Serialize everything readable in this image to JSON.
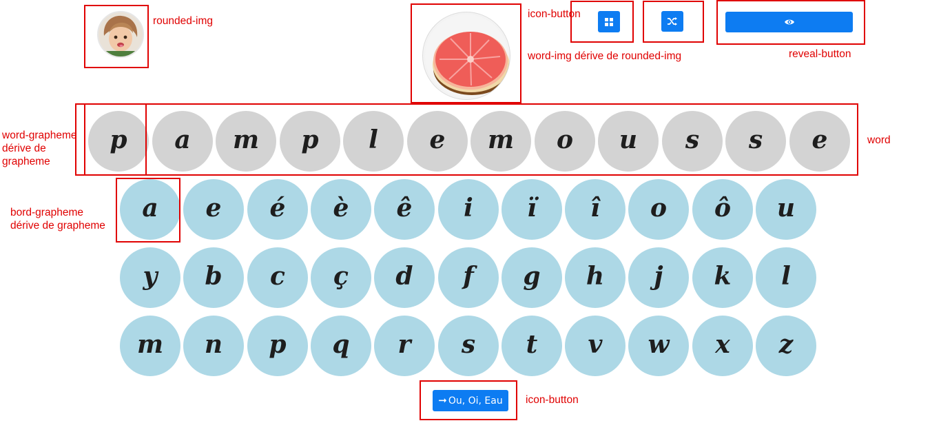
{
  "annotations": {
    "rounded_img": "rounded-img",
    "icon_button_top": "icon-button",
    "word_img": "word-img dérive de rounded-img",
    "reveal_button": "reveal-button",
    "word": "word",
    "word_grapheme": "word-grapheme\ndérive de\ngrapheme",
    "bord_grapheme": "bord-grapheme\ndérive de grapheme",
    "icon_button_bottom": "icon-button"
  },
  "toolbar": {
    "grid_icon": "grid-icon",
    "shuffle_icon": "shuffle-icon",
    "reveal_icon": "eye-icon"
  },
  "word": [
    "p",
    "a",
    "m",
    "p",
    "l",
    "e",
    "m",
    "o",
    "u",
    "s",
    "s",
    "e"
  ],
  "board": [
    [
      "a",
      "e",
      "é",
      "è",
      "ê",
      "i",
      "ï",
      "î",
      "o",
      "ô",
      "u"
    ],
    [
      "y",
      "b",
      "c",
      "ç",
      "d",
      "f",
      "g",
      "h",
      "j",
      "k",
      "l"
    ],
    [
      "m",
      "n",
      "p",
      "q",
      "r",
      "s",
      "t",
      "v",
      "w",
      "x",
      "z"
    ]
  ],
  "next_button": {
    "icon": "arrow-right-icon",
    "label": "Ou, Oi, Eau"
  },
  "colors": {
    "accent": "#0d7cf2",
    "word_grapheme_bg": "#d3d3d3",
    "board_grapheme_bg": "#add8e6",
    "annotation": "#e00000"
  }
}
